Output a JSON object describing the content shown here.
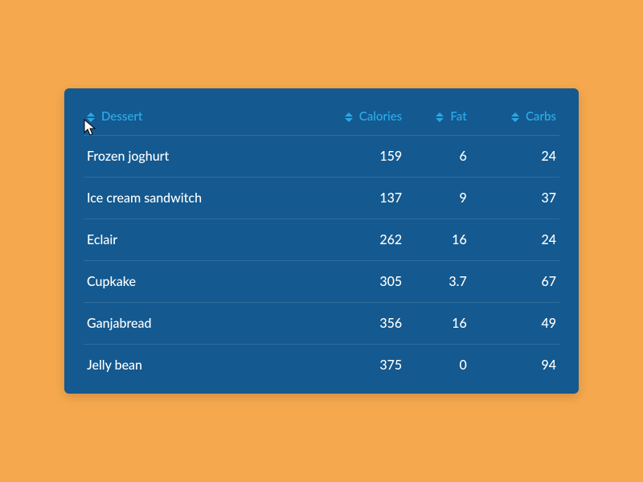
{
  "table": {
    "headers": {
      "dessert": "Dessert",
      "calories": "Calories",
      "fat": "Fat",
      "carbs": "Carbs"
    },
    "rows": [
      {
        "name": "Frozen joghurt",
        "calories": "159",
        "fat": "6",
        "carbs": "24"
      },
      {
        "name": "Ice cream sandwitch",
        "calories": "137",
        "fat": "9",
        "carbs": "37"
      },
      {
        "name": "Eclair",
        "calories": "262",
        "fat": "16",
        "carbs": "24"
      },
      {
        "name": "Cupkake",
        "calories": "305",
        "fat": "3.7",
        "carbs": "67"
      },
      {
        "name": "Ganjabread",
        "calories": "356",
        "fat": "16",
        "carbs": "49"
      },
      {
        "name": "Jelly bean",
        "calories": "375",
        "fat": "0",
        "carbs": "94"
      }
    ]
  },
  "colors": {
    "page_bg": "#f5a84d",
    "card_bg": "#14598f",
    "header_text": "#2aa8e6",
    "cell_text": "#ffffff"
  }
}
